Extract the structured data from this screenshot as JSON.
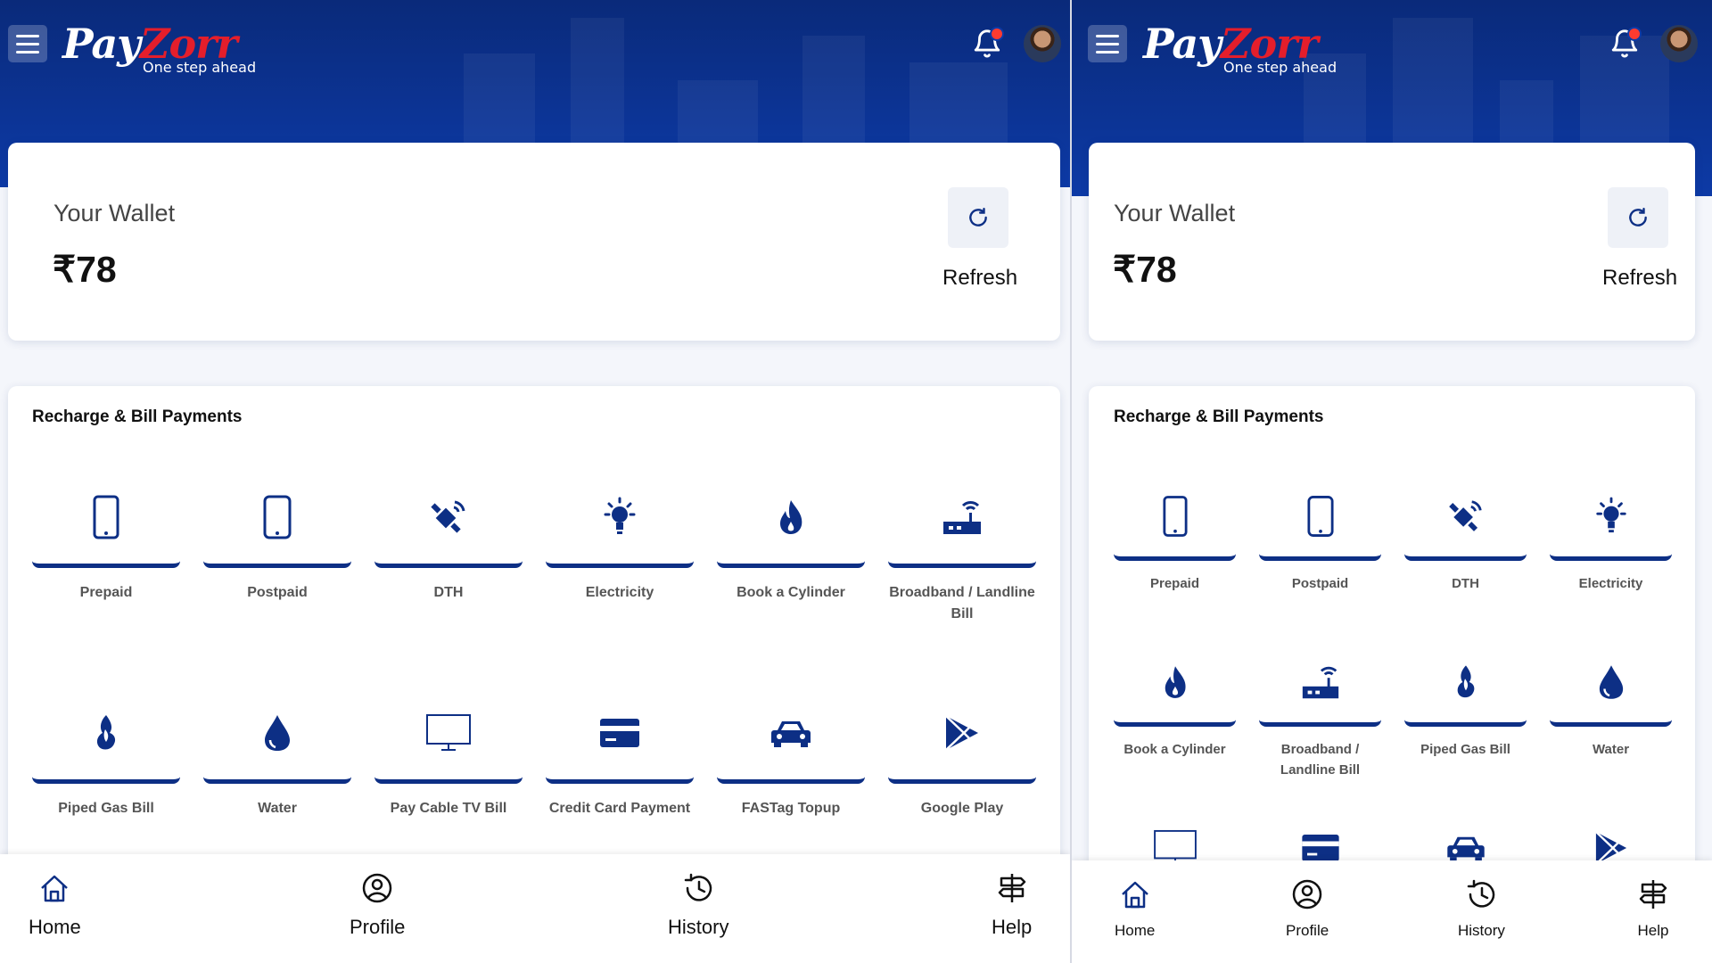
{
  "brand": {
    "name_part1": "Pay",
    "name_part2": "Zorr",
    "tagline": "One step ahead",
    "colors": {
      "primary": "#0d3aa6",
      "accent_red": "#e41e2b",
      "icon": "#0d2f85"
    }
  },
  "header": {
    "menu_icon": "hamburger-menu-icon",
    "notification_icon": "bell-icon",
    "avatar_icon": "user-avatar"
  },
  "wallet": {
    "title": "Your Wallet",
    "amount": "₹78",
    "refresh_label": "Refresh",
    "refresh_icon": "refresh-icon"
  },
  "services": {
    "title": "Recharge & Bill Payments",
    "items": [
      {
        "label": "Prepaid",
        "icon": "mobile-phone-icon"
      },
      {
        "label": "Postpaid",
        "icon": "mobile-phone-icon"
      },
      {
        "label": "DTH",
        "icon": "satellite-icon"
      },
      {
        "label": "Electricity",
        "icon": "bulb-icon"
      },
      {
        "label": "Book a Cylinder",
        "icon": "flame-icon"
      },
      {
        "label": "Broadband / Landline Bill",
        "icon": "router-icon"
      },
      {
        "label": "Piped Gas Bill",
        "icon": "gas-flame-icon"
      },
      {
        "label": "Water",
        "icon": "water-drop-icon"
      },
      {
        "label": "Pay Cable TV Bill",
        "icon": "tv-monitor-icon"
      },
      {
        "label": "Credit Card Payment",
        "icon": "credit-card-icon"
      },
      {
        "label": "FASTag Topup",
        "icon": "car-icon"
      },
      {
        "label": "Google Play",
        "icon": "google-play-icon"
      }
    ]
  },
  "bottom_nav": [
    {
      "label": "Home",
      "icon": "home-icon"
    },
    {
      "label": "Profile",
      "icon": "profile-icon"
    },
    {
      "label": "History",
      "icon": "history-icon"
    },
    {
      "label": "Help",
      "icon": "signpost-icon"
    }
  ]
}
